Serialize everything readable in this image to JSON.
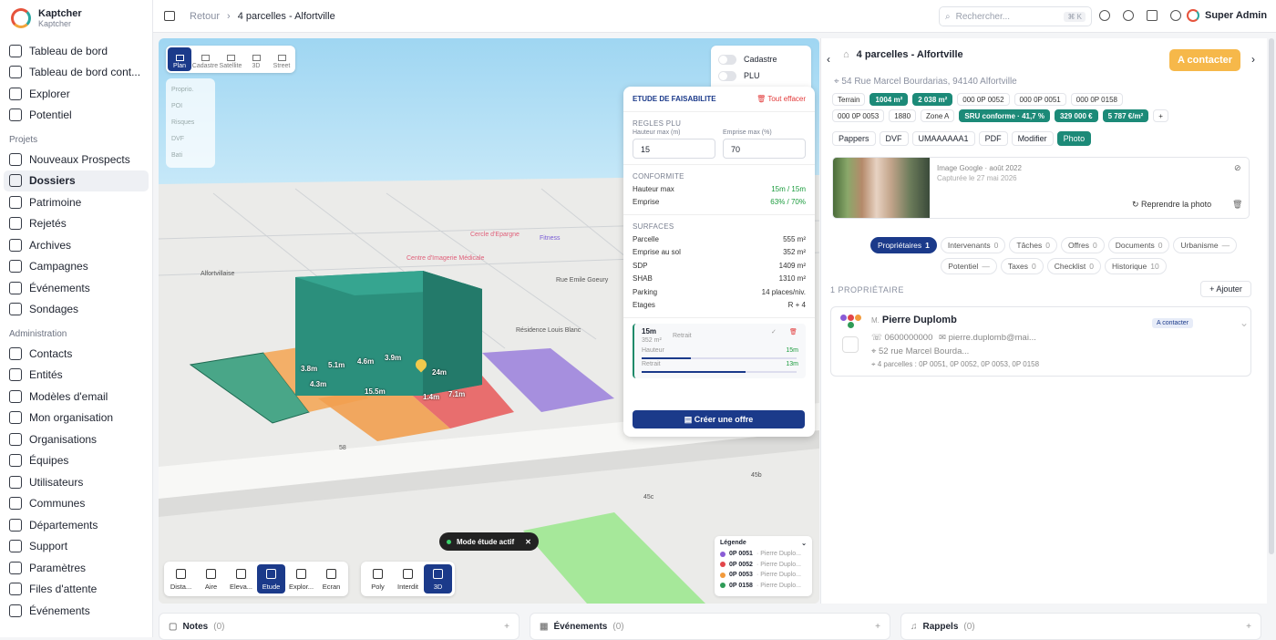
{
  "app": {
    "name": "Kaptcher",
    "sub": "Kaptcher"
  },
  "nav": {
    "main": [
      "Tableau de bord",
      "Tableau de bord cont...",
      "Explorer",
      "Potentiel"
    ],
    "projets_label": "Projets",
    "projets": [
      "Nouveaux Prospects",
      "Dossiers",
      "Patrimoine",
      "Rejetés",
      "Archives",
      "Campagnes",
      "Événements",
      "Sondages"
    ],
    "admin_label": "Administration",
    "admin": [
      "Contacts",
      "Entités",
      "Modèles d'email",
      "Mon organisation",
      "Organisations",
      "Équipes",
      "Utilisateurs",
      "Communes",
      "Départements",
      "Support",
      "Paramètres",
      "Files d'attente",
      "Événements"
    ]
  },
  "breadcrumb": {
    "back": "Retour",
    "current": "4 parcelles - Alfortville"
  },
  "search": {
    "placeholder": "Rechercher...",
    "kbd": "⌘ K"
  },
  "user": {
    "name": "Super Admin"
  },
  "map": {
    "tabs": [
      "Plan",
      "Cadastre",
      "Satellite",
      "3D",
      "Street"
    ],
    "layers": [
      "Proprio.",
      "POI",
      "Risques",
      "DVF",
      "Bati"
    ],
    "toggles": [
      "Cadastre",
      "PLU"
    ],
    "streets": [
      "Rue Emile Goeury",
      "Résidence Louis Blanc",
      "Alfortvillaise",
      "Centre d'Imagerie Médicale",
      "Cercle d'Epargne",
      "Fitness"
    ],
    "measures": [
      "3.8m",
      "5.1m",
      "4.6m",
      "3.9m",
      "24m",
      "4.3m",
      "15.5m",
      "1.4m",
      "7.1m"
    ],
    "numbers": [
      "58",
      "45b",
      "45c"
    ],
    "mode": "Mode étude actif",
    "tools": [
      "Dista...",
      "Aire",
      "Eleva...",
      "Etude",
      "Explor...",
      "Ecran"
    ],
    "tools2": [
      "Poly",
      "Interdit",
      "3D"
    ],
    "legend": {
      "title": "Légende",
      "items": [
        {
          "code": "0P 0051",
          "owner": "· Pierre Duplo...",
          "color": "#8a5cd6"
        },
        {
          "code": "0P 0052",
          "owner": "· Pierre Duplo...",
          "color": "#e2454a"
        },
        {
          "code": "0P 0053",
          "owner": "· Pierre Duplo...",
          "color": "#f29a3b"
        },
        {
          "code": "0P 0158",
          "owner": "· Pierre Duplo...",
          "color": "#2f9b57"
        }
      ]
    }
  },
  "etude": {
    "title": "ETUDE DE FAISABILITE",
    "clear": "Tout effacer",
    "plu_label": "REGLES PLU",
    "h_label": "Hauteur max (m)",
    "h_val": "15",
    "e_label": "Emprise max (%)",
    "e_val": "70",
    "conf_label": "CONFORMITE",
    "conf": [
      {
        "k": "Hauteur max",
        "v": "15m / 15m"
      },
      {
        "k": "Emprise",
        "v": "63% / 70%"
      }
    ],
    "surf_label": "SURFACES",
    "surf": [
      {
        "k": "Parcelle",
        "v": "555 m²"
      },
      {
        "k": "Emprise au sol",
        "v": "352 m²"
      },
      {
        "k": "SDP",
        "v": "1409 m²"
      },
      {
        "k": "SHAB",
        "v": "1310 m²"
      },
      {
        "k": "Parking",
        "v": "14 places/niv."
      },
      {
        "k": "Etages",
        "v": "R + 4"
      }
    ],
    "box": {
      "h": "15m",
      "area": "352 m²",
      "retrait": "Retrait",
      "hauteur": "Hauteur",
      "hv": "15m",
      "retrait2": "Retrait",
      "rv": "13m"
    },
    "cta": "Créer une offre"
  },
  "panel": {
    "title": "4 parcelles - Alfortville",
    "address": "54 Rue Marcel Bourdarias, 94140 Alfortville",
    "status": "A contacter",
    "chips1": [
      {
        "t": "Terrain",
        "on": false
      },
      {
        "t": "1004 m²",
        "on": true
      },
      {
        "t": "2 038 m²",
        "on": true
      },
      {
        "t": "000 0P 0052",
        "on": false
      },
      {
        "t": "000 0P 0051",
        "on": false
      },
      {
        "t": "000 0P 0158",
        "on": false
      }
    ],
    "chips2": [
      {
        "t": "000 0P 0053",
        "on": false
      },
      {
        "t": "1880",
        "on": false
      },
      {
        "t": "Zone A",
        "on": false
      },
      {
        "t": "SRU conforme · 41,7 %",
        "on": true
      },
      {
        "t": "329 000 €",
        "on": true
      },
      {
        "t": "5 787 €/m²",
        "on": true
      },
      {
        "t": "+",
        "on": false
      }
    ],
    "actions": [
      "Pappers",
      "DVF",
      "UMAAAAAA1",
      "PDF",
      "Modifier",
      "Photo"
    ],
    "photo": {
      "source": "Image Google · août 2022",
      "captured": "Capturée le 27 mai 2026",
      "retake": "Reprendre la photo"
    },
    "tabs1": [
      {
        "t": "Propriétaires",
        "n": "1",
        "on": true
      },
      {
        "t": "Intervenants",
        "n": "0"
      },
      {
        "t": "Tâches",
        "n": "0"
      },
      {
        "t": "Offres",
        "n": "0"
      },
      {
        "t": "Documents",
        "n": "0"
      },
      {
        "t": "Urbanisme",
        "n": "—"
      }
    ],
    "tabs2": [
      {
        "t": "Potentiel",
        "n": "—"
      },
      {
        "t": "Taxes",
        "n": "0"
      },
      {
        "t": "Checklist",
        "n": "0"
      },
      {
        "t": "Historique",
        "n": "10"
      }
    ],
    "owners_label": "1 PROPRIÉTAIRE",
    "add": "+ Ajouter",
    "owner": {
      "civ": "M.",
      "name": "Pierre Duplomb",
      "badge": "A contacter",
      "phone": "0600000000",
      "email": "pierre.duplomb@mai...",
      "addr": "52 rue Marcel Bourda...",
      "parcels": "4 parcelles : 0P 0051, 0P 0052, 0P 0053, 0P 0158"
    }
  },
  "bottom": [
    {
      "t": "Notes",
      "n": "(0)"
    },
    {
      "t": "Événements",
      "n": "(0)"
    },
    {
      "t": "Rappels",
      "n": "(0)"
    }
  ]
}
